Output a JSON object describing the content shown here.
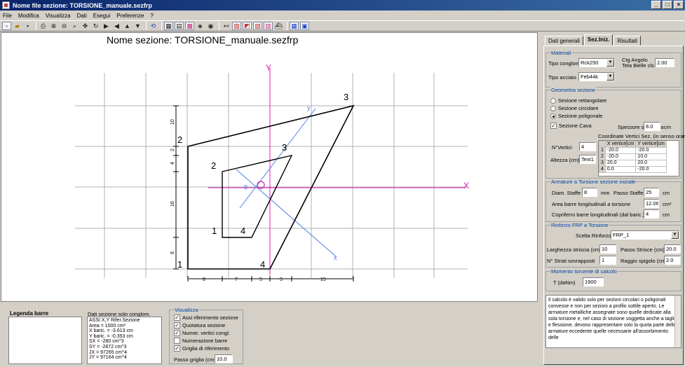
{
  "window": {
    "title": "Nome file sezione: TORSIONE_manuale.sezfrp",
    "min": "_",
    "max": "□",
    "close": "×"
  },
  "menu": [
    "File",
    "Modifica",
    "Visualizza",
    "Dati",
    "Esegui",
    "Preferenze",
    "?"
  ],
  "canvas": {
    "title": "Nome sezione: TORSIONE_manuale.sezfrp",
    "axis_x": "X",
    "axis_y": "Y",
    "axis_u": "y",
    "axis_v": "x",
    "label_b": "B",
    "label_o": "O",
    "outer_labels": [
      "1",
      "2",
      "3",
      "4"
    ],
    "inner_labels": [
      "1",
      "2",
      "3",
      "4"
    ],
    "dims_vertical": [
      "10",
      "2",
      "4",
      "16",
      "8"
    ],
    "dims_horizontal": [
      "8",
      "7",
      "5",
      "5",
      "15"
    ]
  },
  "tabs": [
    "Dati generali",
    "Sez.Iniz.",
    "Risultati"
  ],
  "materiali": {
    "title": "Materiali",
    "tipo_conglom_label": "Tipo conglom.",
    "tipo_conglom_value": "Rck250",
    "ctg_label_1": "Ctg Angolo",
    "ctg_label_2": "Teta Bielle cls.",
    "ctg_value": "2.00",
    "tipo_acciaio_label": "Tipo acciaio",
    "tipo_acciaio_value": "Feb44k"
  },
  "geometria": {
    "title": "Geometria sezione",
    "radio_rett": "Sezione rettangolare",
    "radio_circ": "Sezione circolare",
    "radio_poli": "Sezione poligonale",
    "cava_label": "Sezione Cava",
    "spessore_label": "Spessore sez. cava",
    "spessore_value": "8.0",
    "spessore_unit": "cm",
    "coord_title": "Coordinate Vertici Sez. (in senso orario)",
    "nvertici_label": "N°Vertici",
    "nvertici_value": "4",
    "altezza_label": "Altezza (cm)",
    "altezza_value": "Text1",
    "col_x": "X vertice[cm",
    "col_y": "Y vertice[cm",
    "rows": [
      {
        "n": "1",
        "x": "-20.0",
        "y": "-20.0"
      },
      {
        "n": "2",
        "x": "-20.0",
        "y": "10.0"
      },
      {
        "n": "3",
        "x": "20.0",
        "y": "20.0"
      },
      {
        "n": "4",
        "x": "0.0",
        "y": "-20.0"
      }
    ]
  },
  "armature": {
    "title": "Armature a Torsione sezione iniziale",
    "diam_label": "Diam. Staffe",
    "diam_value": "8",
    "diam_unit": "mm",
    "passo_label": "Passo Staffe",
    "passo_value": "25",
    "passo_unit": "cm",
    "area_label": "Area barre longitudinali a torsione",
    "area_value": "12.06",
    "area_unit": "cm²",
    "copri_label": "Copriferro barre longitudinali (dal baric.)",
    "copri_value": "4",
    "copri_unit": "cm"
  },
  "frp": {
    "title": "Rinforzo FRP a Torsione",
    "scelta_label": "Scelta Rinforzo:",
    "scelta_value": "FRP_1",
    "largh_label": "Larghezza striscia (cm)",
    "largh_value": "10",
    "passo_label": "Passo Strisce (cm)",
    "passo_value": "20.0",
    "strati_label": "N° Strati sovrapposti",
    "strati_value": "1",
    "raggio_label": "Raggio spigolo (cm)",
    "raggio_value": "2.0"
  },
  "momento": {
    "title": "Momento torcente di calcolo",
    "t_label": "T (daNm)",
    "t_value": "1900"
  },
  "note": "Il calcolo è valido solo per sezioni circolari o poligonali convesse e non per sezioni a profilo sottile aperto. Le armature metalliche assegnate sono quelle dedicate alla sola torsione e, nel caso di sezione soggetta anche a taglio e flessione, devono rappresentare solo la quota parte delle armature eccedente quelle necessarie all'assorbimento delle",
  "bottom": {
    "legend_title": "Legenda barre",
    "dati_title": "Dati sezione solo conglom.",
    "dati_lines": [
      "ASSI X,Y   Rifer.Sezione",
      "Area = 1000 cm²",
      "X baric. = -3.613 cm",
      "Y baric. = -0.353 cm",
      "SX  = -280 cm^3",
      "SY  = -2872 cm^3",
      "JX  = 97265 cm^4",
      "JY  = 97164 cm^4"
    ],
    "vis_title": "Visualizza",
    "vis_items": [
      {
        "label": "Assi riferimento sezione",
        "checked": true
      },
      {
        "label": "Quotatura sezione",
        "checked": true
      },
      {
        "label": "Numer. vertici congl.",
        "checked": true
      },
      {
        "label": "Numerazione barre",
        "checked": false
      },
      {
        "label": "Griglia di riferimento",
        "checked": true
      }
    ],
    "passo_label": "Passo griglia (cm)",
    "passo_value": "10.0"
  }
}
